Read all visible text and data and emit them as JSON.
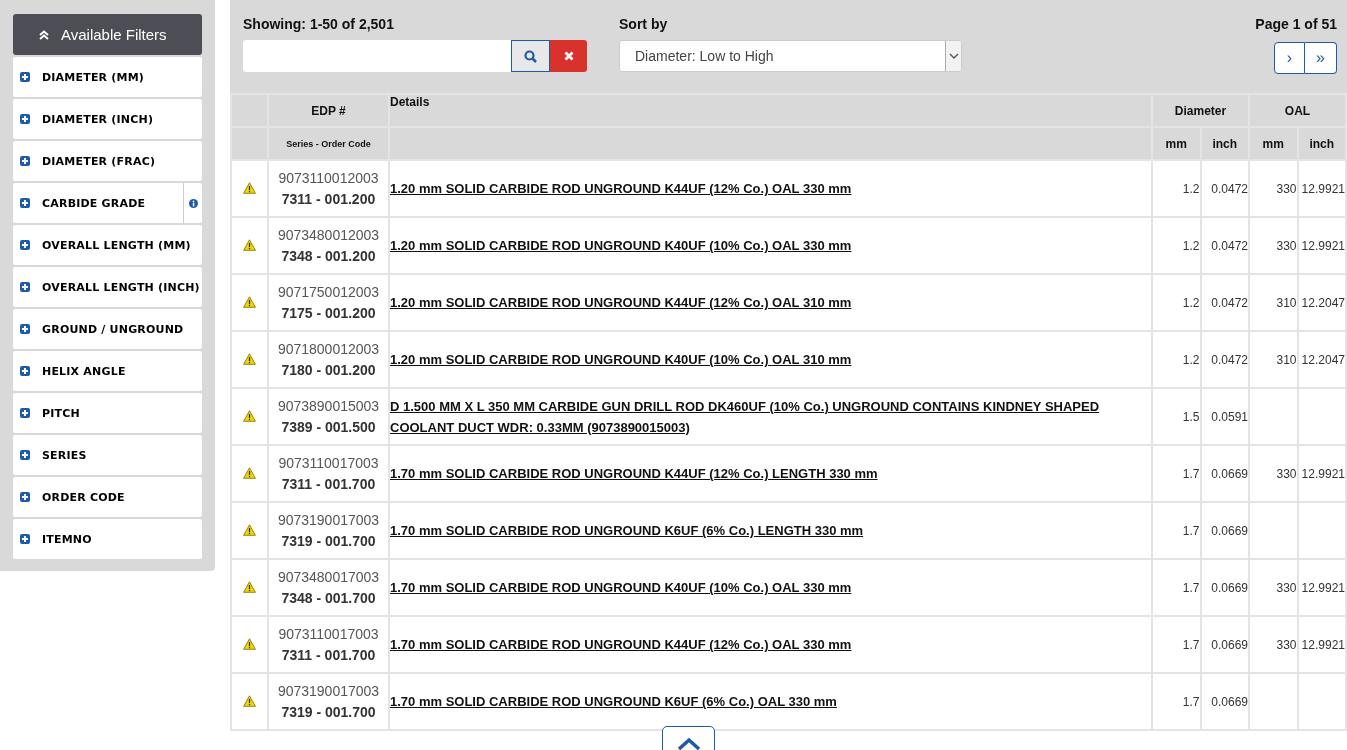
{
  "sidebar": {
    "title": "Available Filters",
    "expanded": true,
    "filters": [
      {
        "label": "DIAMETER (MM)"
      },
      {
        "label": "DIAMETER (INCH)"
      },
      {
        "label": "DIAMETER (FRAC)"
      },
      {
        "label": "CARBIDE GRADE",
        "info": true
      },
      {
        "label": "OVERALL LENGTH (MM)"
      },
      {
        "label": "OVERALL LENGTH (INCH)"
      },
      {
        "label": "GROUND / UNGROUND"
      },
      {
        "label": "HELIX ANGLE"
      },
      {
        "label": "PITCH"
      },
      {
        "label": "SERIES"
      },
      {
        "label": "ORDER CODE"
      },
      {
        "label": "ITEMNO"
      }
    ]
  },
  "toolbar": {
    "showing": "Showing: 1-50 of 2,501",
    "sort_label": "Sort by",
    "sort_value": "Diameter: Low to High",
    "page": "Page 1 of 51",
    "next": "›",
    "last": "»"
  },
  "table": {
    "columns": {
      "edp": "EDP #",
      "details": "Details",
      "diameter": "Diameter",
      "oal": "OAL",
      "sub_edp": "Series - Order Code",
      "mm": "mm",
      "inch": "inch",
      "oal_mm": "mm",
      "oal_inch": "inch"
    },
    "rows": [
      {
        "warning": true,
        "edp": "9073110012003",
        "code": "7311 - 001.200",
        "details": "1.20 mm SOLID CARBIDE ROD UNGROUND K44UF (12% Co.) OAL 330 mm",
        "dia_mm": "1.2",
        "dia_inch": "0.0472",
        "oal_mm": "330",
        "oal_inch": "12.9921"
      },
      {
        "warning": true,
        "edp": "9073480012003",
        "code": "7348 - 001.200",
        "details": "1.20 mm SOLID CARBIDE ROD UNGROUND K40UF (10% Co.) OAL 330 mm",
        "dia_mm": "1.2",
        "dia_inch": "0.0472",
        "oal_mm": "330",
        "oal_inch": "12.9921"
      },
      {
        "warning": true,
        "edp": "9071750012003",
        "code": "7175 - 001.200",
        "details": "1.20 mm SOLID CARBIDE ROD UNGROUND K44UF (12% Co.) OAL 310 mm",
        "dia_mm": "1.2",
        "dia_inch": "0.0472",
        "oal_mm": "310",
        "oal_inch": "12.2047"
      },
      {
        "warning": true,
        "edp": "9071800012003",
        "code": "7180 - 001.200",
        "details": "1.20 mm SOLID CARBIDE ROD UNGROUND K40UF (10% Co.) OAL 310 mm",
        "dia_mm": "1.2",
        "dia_inch": "0.0472",
        "oal_mm": "310",
        "oal_inch": "12.2047"
      },
      {
        "warning": true,
        "edp": "9073890015003",
        "code": "7389 - 001.500",
        "details": "D 1.500 MM X L 350 MM CARBIDE GUN DRILL ROD DK460UF (10% Co.) UNGROUND CONTAINS KINDNEY SHAPED COOLANT DUCT WDR: 0.33MM (9073890015003)",
        "dia_mm": "1.5",
        "dia_inch": "0.0591"
      },
      {
        "warning": true,
        "edp": "9073110017003",
        "code": "7311 - 001.700",
        "details": "1.70 mm SOLID CARBIDE ROD UNGROUND K44UF (12% Co.) LENGTH 330 mm",
        "dia_mm": "1.7",
        "dia_inch": "0.0669",
        "oal_mm": "330",
        "oal_inch": "12.9921"
      },
      {
        "warning": true,
        "edp": "9073190017003",
        "code": "7319 - 001.700",
        "details": "1.70 mm SOLID CARBIDE ROD UNGROUND K6UF (6% Co.) LENGTH 330 mm",
        "dia_mm": "1.7",
        "dia_inch": "0.0669"
      },
      {
        "warning": true,
        "edp": "9073480017003",
        "code": "7348 - 001.700",
        "details": "1.70 mm SOLID CARBIDE ROD UNGROUND K40UF (10% Co.) OAL 330 mm",
        "dia_mm": "1.7",
        "dia_inch": "0.0669",
        "oal_mm": "330",
        "oal_inch": "12.9921"
      },
      {
        "warning": true,
        "edp": "9073110017003",
        "code": "7311 - 001.700",
        "details": "1.70 mm SOLID CARBIDE ROD UNGROUND K44UF (12% Co.) OAL 330 mm",
        "dia_mm": "1.7",
        "dia_inch": "0.0669",
        "oal_mm": "330",
        "oal_inch": "12.9921"
      },
      {
        "warning": true,
        "edp": "9073190017003",
        "code": "7319 - 001.700",
        "details": "1.70 mm SOLID CARBIDE ROD UNGROUND K6UF (6% Co.) OAL 330 mm",
        "dia_mm": "1.7",
        "dia_inch": "0.0669"
      }
    ]
  }
}
